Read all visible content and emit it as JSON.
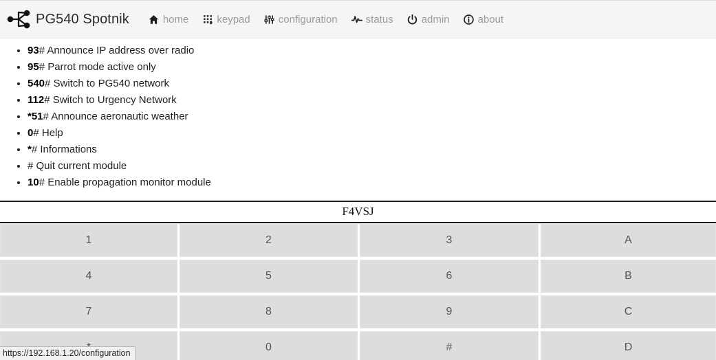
{
  "navbar": {
    "brand": {
      "label": "PG540 Spotnik",
      "logo_icon": "spotnik-network-logo"
    },
    "items": [
      {
        "label": "home",
        "icon": "home-icon"
      },
      {
        "label": "keypad",
        "icon": "keypad-dots-icon"
      },
      {
        "label": "configuration",
        "icon": "sliders-icon"
      },
      {
        "label": "status",
        "icon": "pulse-icon"
      },
      {
        "label": "admin",
        "icon": "power-icon"
      },
      {
        "label": "about",
        "icon": "info-circle-icon"
      }
    ]
  },
  "commands": [
    {
      "code": "93",
      "suffix": "# ",
      "description": "Announce IP address over radio"
    },
    {
      "code": "95",
      "suffix": "# ",
      "description": "Parrot mode active only"
    },
    {
      "code": "540",
      "suffix": "# ",
      "description": "Switch to PG540 network"
    },
    {
      "code": "112",
      "suffix": "# ",
      "description": "Switch to Urgency Network"
    },
    {
      "code": "*51",
      "suffix": "# ",
      "description": "Announce aeronautic weather"
    },
    {
      "code": "0",
      "suffix": "# ",
      "description": "Help"
    },
    {
      "code": "*",
      "suffix": "# ",
      "description": "Informations"
    },
    {
      "code": "",
      "suffix": "# ",
      "description": "Quit current module"
    },
    {
      "code": "10",
      "suffix": "# ",
      "description": "Enable propagation monitor module"
    }
  ],
  "callsign": "F4VSJ",
  "keypad": {
    "rows": [
      [
        "1",
        "2",
        "3",
        "A"
      ],
      [
        "4",
        "5",
        "6",
        "B"
      ],
      [
        "7",
        "8",
        "9",
        "C"
      ],
      [
        "*",
        "0",
        "#",
        "D"
      ]
    ]
  },
  "statusbar": {
    "url": "https://192.168.1.20/configuration"
  },
  "colors": {
    "navbar_bg": "#f5f5f5",
    "key_bg": "#dddddd",
    "key_text": "#555555",
    "nav_label": "#9a9a9a",
    "brand_text": "#2b2b2b"
  }
}
